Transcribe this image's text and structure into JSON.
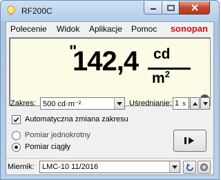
{
  "window": {
    "title": "RF200C"
  },
  "menu": {
    "items": [
      "Polecenie",
      "Widok",
      "Aplikacje",
      "Pomoc"
    ],
    "brand": "sonopan"
  },
  "display": {
    "quote": "\"",
    "reading": "142,4",
    "unit_numerator": "cd",
    "unit_denominator": "m",
    "unit_exponent": "2"
  },
  "range": {
    "label": "Zakres:",
    "value": "500 cd·m⁻²"
  },
  "averaging": {
    "label": "Uśrednianie:",
    "value": "1",
    "unit": "s"
  },
  "auto_range": {
    "label": "Automatyczna zmiana zakresu",
    "checked": true
  },
  "mode": {
    "options": [
      "Pomiar jednokrotny",
      "Pomiar ciągły"
    ],
    "selected": "Pomiar ciągły"
  },
  "meter": {
    "label": "Miernik:",
    "value": "LMC-10 11/2016"
  },
  "colors": {
    "brand": "#e30613",
    "display_bg": "#fcfbe6",
    "led": "#e6e600"
  },
  "icons": [
    "lightbulb-icon",
    "minimize-icon",
    "maximize-icon",
    "close-icon",
    "play-pause-icon",
    "refresh-icon",
    "settings-icon"
  ]
}
